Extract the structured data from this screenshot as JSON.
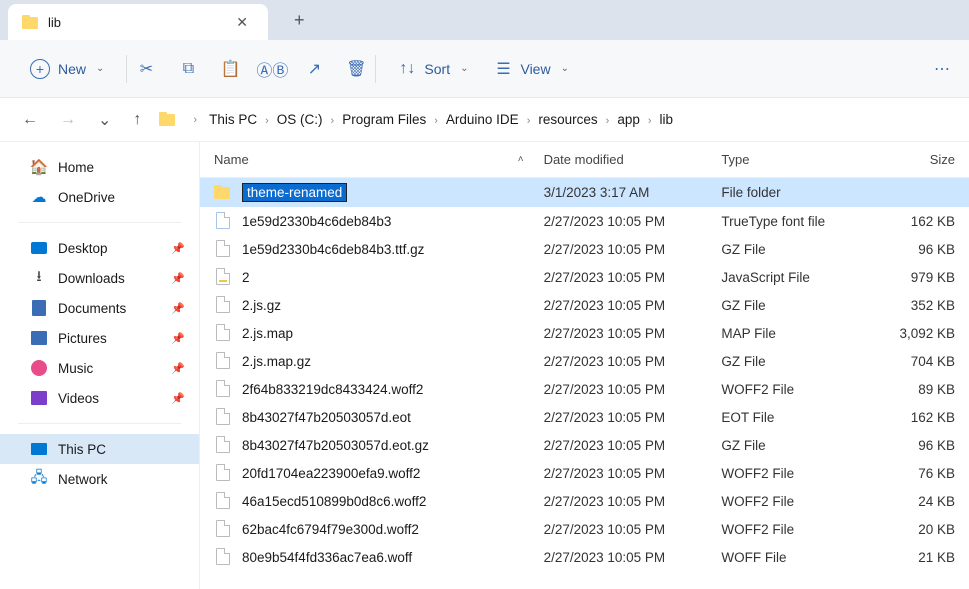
{
  "tabs": {
    "title": "lib"
  },
  "toolbar": {
    "new_label": "New",
    "sort_label": "Sort",
    "view_label": "View"
  },
  "breadcrumbs": [
    "This PC",
    "OS (C:)",
    "Program Files",
    "Arduino IDE",
    "resources",
    "app",
    "lib"
  ],
  "sidebar": {
    "quick": [
      {
        "label": "Home",
        "icon": "home"
      },
      {
        "label": "OneDrive",
        "icon": "onedrive"
      }
    ],
    "pinned": [
      {
        "label": "Desktop",
        "icon": "desktop",
        "pinned": true
      },
      {
        "label": "Downloads",
        "icon": "downloads",
        "pinned": true
      },
      {
        "label": "Documents",
        "icon": "documents",
        "pinned": true
      },
      {
        "label": "Pictures",
        "icon": "pictures",
        "pinned": true
      },
      {
        "label": "Music",
        "icon": "music",
        "pinned": true
      },
      {
        "label": "Videos",
        "icon": "videos",
        "pinned": true
      }
    ],
    "drives": [
      {
        "label": "This PC",
        "icon": "thispc",
        "selected": true
      },
      {
        "label": "Network",
        "icon": "network"
      }
    ]
  },
  "columns": {
    "name": "Name",
    "date": "Date modified",
    "type": "Type",
    "size": "Size"
  },
  "rename_value": "theme-renamed",
  "files": [
    {
      "name": "theme-renamed",
      "date": "3/1/2023 3:17 AM",
      "type": "File folder",
      "size": "",
      "selected": true,
      "icon": "folder",
      "renaming": true
    },
    {
      "name": "1e59d2330b4c6deb84b3",
      "date": "2/27/2023 10:05 PM",
      "type": "TrueType font file",
      "size": "162 KB",
      "icon": "ttf"
    },
    {
      "name": "1e59d2330b4c6deb84b3.ttf.gz",
      "date": "2/27/2023 10:05 PM",
      "type": "GZ File",
      "size": "96 KB",
      "icon": "file"
    },
    {
      "name": "2",
      "date": "2/27/2023 10:05 PM",
      "type": "JavaScript File",
      "size": "979 KB",
      "icon": "js"
    },
    {
      "name": "2.js.gz",
      "date": "2/27/2023 10:05 PM",
      "type": "GZ File",
      "size": "352 KB",
      "icon": "file"
    },
    {
      "name": "2.js.map",
      "date": "2/27/2023 10:05 PM",
      "type": "MAP File",
      "size": "3,092 KB",
      "icon": "file"
    },
    {
      "name": "2.js.map.gz",
      "date": "2/27/2023 10:05 PM",
      "type": "GZ File",
      "size": "704 KB",
      "icon": "file"
    },
    {
      "name": "2f64b833219dc8433424.woff2",
      "date": "2/27/2023 10:05 PM",
      "type": "WOFF2 File",
      "size": "89 KB",
      "icon": "file"
    },
    {
      "name": "8b43027f47b20503057d.eot",
      "date": "2/27/2023 10:05 PM",
      "type": "EOT File",
      "size": "162 KB",
      "icon": "file"
    },
    {
      "name": "8b43027f47b20503057d.eot.gz",
      "date": "2/27/2023 10:05 PM",
      "type": "GZ File",
      "size": "96 KB",
      "icon": "file"
    },
    {
      "name": "20fd1704ea223900efa9.woff2",
      "date": "2/27/2023 10:05 PM",
      "type": "WOFF2 File",
      "size": "76 KB",
      "icon": "file"
    },
    {
      "name": "46a15ecd510899b0d8c6.woff2",
      "date": "2/27/2023 10:05 PM",
      "type": "WOFF2 File",
      "size": "24 KB",
      "icon": "file"
    },
    {
      "name": "62bac4fc6794f79e300d.woff2",
      "date": "2/27/2023 10:05 PM",
      "type": "WOFF2 File",
      "size": "20 KB",
      "icon": "file"
    },
    {
      "name": "80e9b54f4fd336ac7ea6.woff",
      "date": "2/27/2023 10:05 PM",
      "type": "WOFF File",
      "size": "21 KB",
      "icon": "file"
    }
  ]
}
